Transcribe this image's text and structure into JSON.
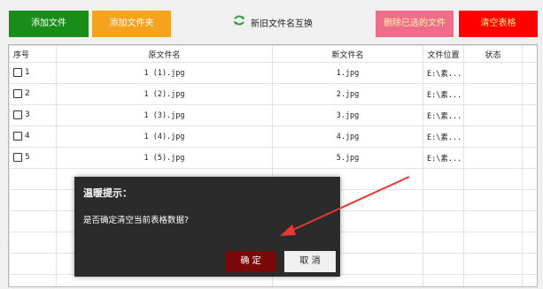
{
  "toolbar": {
    "add_file": "添加文件",
    "add_folder": "添加文件夹",
    "swap_names": "新旧文件名互换",
    "delete_selected": "删除已选的文件",
    "clear_table": "清空表格"
  },
  "table": {
    "headers": [
      "序号",
      "原文件名",
      "新文件名",
      "文件位置",
      "状态"
    ],
    "rows": [
      {
        "index": "1",
        "original": "1 (1).jpg",
        "new": "1.jpg",
        "location": "E:\\素...",
        "status": ""
      },
      {
        "index": "2",
        "original": "1 (2).jpg",
        "new": "2.jpg",
        "location": "E:\\素...",
        "status": ""
      },
      {
        "index": "3",
        "original": "1 (3).jpg",
        "new": "3.jpg",
        "location": "E:\\素...",
        "status": ""
      },
      {
        "index": "4",
        "original": "1 (4).jpg",
        "new": "4.jpg",
        "location": "E:\\素...",
        "status": ""
      },
      {
        "index": "5",
        "original": "1 (5).jpg",
        "new": "5.jpg",
        "location": "E:\\素...",
        "status": ""
      }
    ]
  },
  "dialog": {
    "title": "温暖提示：",
    "message": "是否确定清空当前表格数据?",
    "ok_label": "确 定",
    "cancel_label": "取 消"
  },
  "colors": {
    "add_file_bg": "#1a8c1a",
    "add_folder_bg": "#f5a31e",
    "delete_bg": "#f06c8b",
    "clear_bg": "#ff0000",
    "dialog_bg": "#2b2b2b",
    "ok_bg": "#7a0a0a",
    "annotation_arrow": "#e53935"
  },
  "icons": {
    "swap": "swap-arrows-icon",
    "checkbox": "checkbox-icon"
  }
}
